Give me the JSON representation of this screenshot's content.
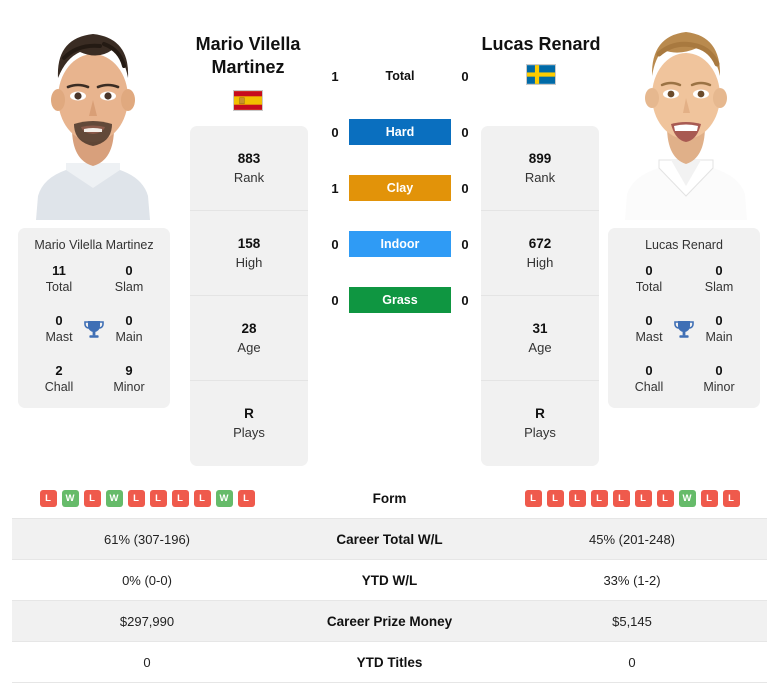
{
  "players": {
    "left": {
      "name": "Mario Vilella Martinez",
      "heading_line1": "Mario Vilella",
      "heading_line2": "Martinez",
      "country": "Spain",
      "flag_icon": "flag-spain-icon",
      "titles": [
        {
          "value": "11",
          "label": "Total"
        },
        {
          "value": "0",
          "label": "Slam"
        },
        {
          "value": "0",
          "label": "Mast"
        },
        {
          "value": "0",
          "label": "Main"
        },
        {
          "value": "2",
          "label": "Chall"
        },
        {
          "value": "9",
          "label": "Minor"
        }
      ],
      "ranking": [
        {
          "value": "883",
          "label": "Rank"
        },
        {
          "value": "158",
          "label": "High"
        },
        {
          "value": "28",
          "label": "Age"
        },
        {
          "value": "R",
          "label": "Plays"
        }
      ],
      "form": [
        "L",
        "W",
        "L",
        "W",
        "L",
        "L",
        "L",
        "L",
        "W",
        "L"
      ],
      "career_total_wl": "61% (307-196)",
      "ytd_wl": "0% (0-0)",
      "career_prize_money": "$297,990",
      "ytd_titles": "0"
    },
    "right": {
      "name": "Lucas Renard",
      "heading_line1": "Lucas Renard",
      "heading_line2": "",
      "country": "Sweden",
      "flag_icon": "flag-sweden-icon",
      "titles": [
        {
          "value": "0",
          "label": "Total"
        },
        {
          "value": "0",
          "label": "Slam"
        },
        {
          "value": "0",
          "label": "Mast"
        },
        {
          "value": "0",
          "label": "Main"
        },
        {
          "value": "0",
          "label": "Chall"
        },
        {
          "value": "0",
          "label": "Minor"
        }
      ],
      "ranking": [
        {
          "value": "899",
          "label": "Rank"
        },
        {
          "value": "672",
          "label": "High"
        },
        {
          "value": "31",
          "label": "Age"
        },
        {
          "value": "R",
          "label": "Plays"
        }
      ],
      "form": [
        "L",
        "L",
        "L",
        "L",
        "L",
        "L",
        "L",
        "W",
        "L",
        "L"
      ],
      "career_total_wl": "45% (201-248)",
      "ytd_wl": "33% (1-2)",
      "career_prize_money": "$5,145",
      "ytd_titles": "0"
    }
  },
  "h2h": [
    {
      "label": "Total",
      "left": "1",
      "right": "0",
      "color": ""
    },
    {
      "label": "Hard",
      "left": "0",
      "right": "0",
      "color": "#0a6fbf"
    },
    {
      "label": "Clay",
      "left": "1",
      "right": "0",
      "color": "#e29309"
    },
    {
      "label": "Indoor",
      "left": "0",
      "right": "0",
      "color": "#2f9bf5"
    },
    {
      "label": "Grass",
      "left": "0",
      "right": "0",
      "color": "#0f9641"
    }
  ],
  "comparison_rows": [
    {
      "label": "Form",
      "type": "form",
      "shaded": false
    },
    {
      "label": "Career Total W/L",
      "type": "text",
      "shaded": true,
      "left": "61% (307-196)",
      "right": "45% (201-248)"
    },
    {
      "label": "YTD W/L",
      "type": "text",
      "shaded": false,
      "left": "0% (0-0)",
      "right": "33% (1-2)"
    },
    {
      "label": "Career Prize Money",
      "type": "text",
      "shaded": true,
      "left": "$297,990",
      "right": "$5,145"
    },
    {
      "label": "YTD Titles",
      "type": "text",
      "shaded": false,
      "left": "0",
      "right": "0"
    }
  ],
  "colors": {
    "hard": "#0a6fbf",
    "clay": "#e29309",
    "indoor": "#2f9bf5",
    "grass": "#0f9641",
    "win_badge": "#66bb6a",
    "loss_badge": "#ef5a4c",
    "trophy": "#3f6fb5",
    "card_bg": "#f1f1f1"
  }
}
